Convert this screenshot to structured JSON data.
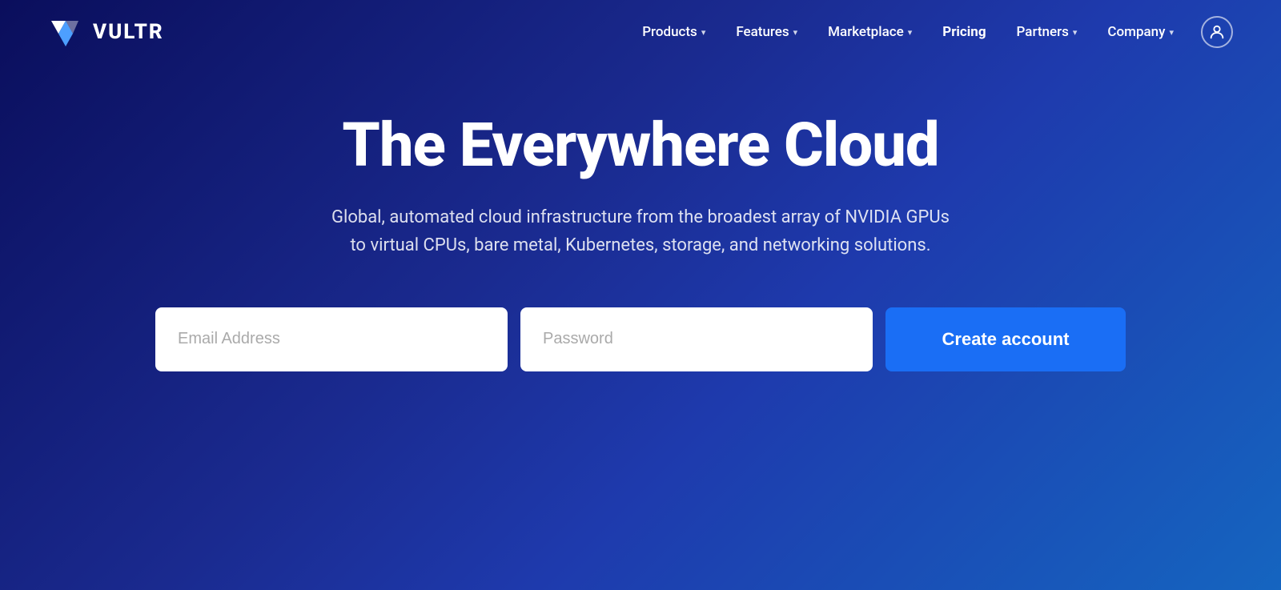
{
  "brand": {
    "logo_text": "VULTR",
    "tagline": "The Everywhere Cloud",
    "description": "Global, automated cloud infrastructure from the broadest array of NVIDIA GPUs to virtual CPUs, bare metal, Kubernetes, storage, and networking solutions."
  },
  "nav": {
    "links": [
      {
        "id": "products",
        "label": "Products",
        "has_dropdown": true
      },
      {
        "id": "features",
        "label": "Features",
        "has_dropdown": true
      },
      {
        "id": "marketplace",
        "label": "Marketplace",
        "has_dropdown": true
      },
      {
        "id": "pricing",
        "label": "Pricing",
        "has_dropdown": false
      },
      {
        "id": "partners",
        "label": "Partners",
        "has_dropdown": true
      },
      {
        "id": "company",
        "label": "Company",
        "has_dropdown": true
      }
    ]
  },
  "signup_form": {
    "email_placeholder": "Email Address",
    "password_placeholder": "Password",
    "cta_label": "Create account"
  }
}
